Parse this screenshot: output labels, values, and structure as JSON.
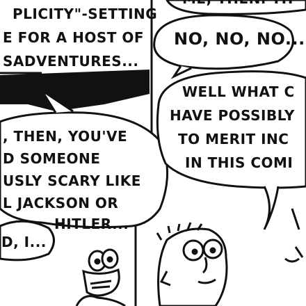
{
  "narration": {
    "line1": "PLICITY\"-SETTING",
    "line2": "E FOR A HOST OF",
    "line3": "SADVENTURES..."
  },
  "top_right_bubble": {
    "line1": "ME, THEN. TH"
  },
  "bubble_no": {
    "text": "NO, NO, NO..."
  },
  "bubble_left": {
    "line1": ", THEN, YOU'VE",
    "line2": "D SOMEONE",
    "line3": "USLY SCARY LIKE",
    "line4": "L JACKSON OR",
    "line5": "HITLER..."
  },
  "bubble_bottom_left": {
    "text": "D, I..."
  },
  "bubble_right": {
    "line1": "WELL WHAT C",
    "line2": "HAVE POSSIBLY",
    "line3": "TO MERIT INC",
    "line4": "IN THIS COMI"
  },
  "colors": {
    "ink": "#111111",
    "paper": "#ffffff"
  }
}
